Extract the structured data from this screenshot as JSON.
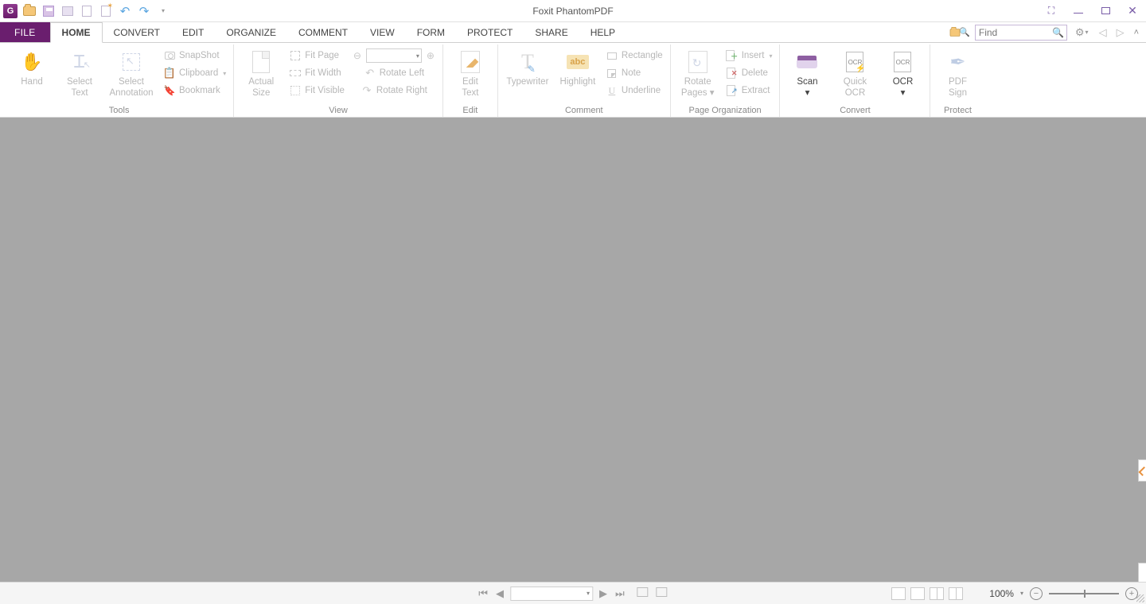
{
  "app": {
    "title": "Foxit PhantomPDF"
  },
  "qat": {
    "logo": "G"
  },
  "window_controls": {
    "fullscreen": "⛶",
    "minimize": "—",
    "restore": "◱",
    "close": "✕"
  },
  "tabs": {
    "file": "FILE",
    "items": [
      "HOME",
      "CONVERT",
      "EDIT",
      "ORGANIZE",
      "COMMENT",
      "VIEW",
      "FORM",
      "PROTECT",
      "SHARE",
      "HELP"
    ],
    "active_index": 0
  },
  "search": {
    "placeholder": "Find"
  },
  "ribbon": {
    "groups": {
      "tools": {
        "label": "Tools",
        "hand": "Hand",
        "select_text": "Select\nText",
        "select_annotation": "Select\nAnnotation",
        "snapshot": "SnapShot",
        "clipboard": "Clipboard",
        "bookmark": "Bookmark"
      },
      "view": {
        "label": "View",
        "actual_size": "Actual\nSize",
        "fit_page": "Fit Page",
        "fit_width": "Fit Width",
        "fit_visible": "Fit Visible",
        "rotate_left": "Rotate Left",
        "rotate_right": "Rotate Right"
      },
      "edit": {
        "label": "Edit",
        "edit_text": "Edit\nText"
      },
      "comment": {
        "label": "Comment",
        "typewriter": "Typewriter",
        "highlight": "Highlight",
        "hl_glyph": "abc",
        "rectangle": "Rectangle",
        "note": "Note",
        "underline": "Underline"
      },
      "page_org": {
        "label": "Page Organization",
        "rotate_pages": "Rotate\nPages",
        "insert": "Insert",
        "delete": "Delete",
        "extract": "Extract"
      },
      "convert": {
        "label": "Convert",
        "scan": "Scan",
        "quick_ocr": "Quick\nOCR",
        "ocr": "OCR",
        "ocr_glyph": "OCR"
      },
      "protect": {
        "label": "Protect",
        "pdf_sign": "PDF\nSign"
      }
    }
  },
  "statusbar": {
    "zoom_pct": "100%"
  }
}
